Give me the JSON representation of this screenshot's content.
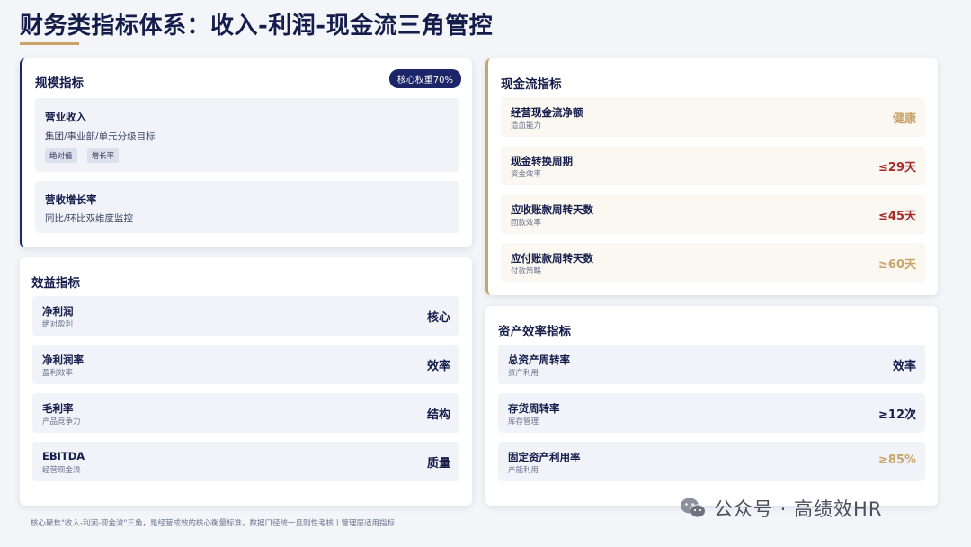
{
  "page": {
    "title": "财务类指标体系：收入-利润-现金流三角管控",
    "footer": "核心聚焦\"收入-利润-现金流\"三角，是经营成效的核心衡量标准，数据口径统一且刚性考核丨管理层适用指标"
  },
  "scale": {
    "title": "规模指标",
    "badge": "核心权重70%",
    "items": [
      {
        "name": "营业收入",
        "desc": "集团/事业部/单元分级目标",
        "tags": [
          "绝对值",
          "增长率"
        ]
      },
      {
        "name": "营收增长率",
        "desc": "同比/环比双维度监控"
      }
    ]
  },
  "benefit": {
    "title": "效益指标",
    "rows": [
      {
        "name": "净利润",
        "sub": "绝对盈利",
        "value": "核心"
      },
      {
        "name": "净利润率",
        "sub": "盈利效率",
        "value": "效率"
      },
      {
        "name": "毛利率",
        "sub": "产品竞争力",
        "value": "结构"
      },
      {
        "name": "EBITDA",
        "sub": "经营现金流",
        "value": "质量"
      }
    ]
  },
  "cash": {
    "title": "现金流指标",
    "rows": [
      {
        "name": "经营现金流净额",
        "sub": "造血能力",
        "value": "健康",
        "color": "#c9a46a"
      },
      {
        "name": "现金转换周期",
        "sub": "资金效率",
        "value": "≤29天",
        "color": "#a52a2a"
      },
      {
        "name": "应收账款周转天数",
        "sub": "回款效率",
        "value": "≤45天",
        "color": "#a52a2a"
      },
      {
        "name": "应付账款周转天数",
        "sub": "付款策略",
        "value": "≥60天",
        "color": "#c9a46a"
      }
    ]
  },
  "asset": {
    "title": "资产效率指标",
    "rows": [
      {
        "name": "总资产周转率",
        "sub": "资产利用",
        "value": "效率",
        "color": "#141c4a"
      },
      {
        "name": "存货周转率",
        "sub": "库存管理",
        "value": "≥12次",
        "color": "#141c4a"
      },
      {
        "name": "固定资产利用率",
        "sub": "产能利用",
        "value": "≥85%",
        "color": "#c9a46a"
      }
    ]
  },
  "watermark": {
    "text": "公众号 · 高绩效HR",
    "icon": "wechat-icon"
  }
}
